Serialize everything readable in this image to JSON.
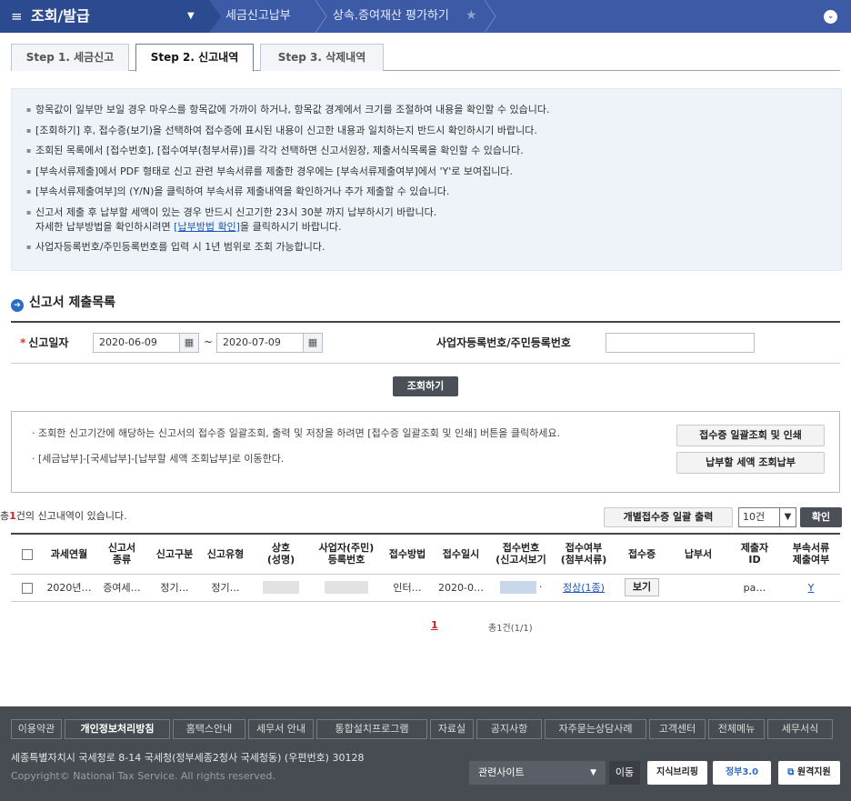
{
  "nav": {
    "title": "조회/발급",
    "crumb1": "세금신고납부",
    "crumb2": "상속.증여재산 평가하기"
  },
  "tabs": [
    {
      "label": "Step 1. 세금신고"
    },
    {
      "label": "Step 2. 신고내역"
    },
    {
      "label": "Step 3. 삭제내역"
    }
  ],
  "info": {
    "items": [
      "항목값이 일부만 보일 경우 마우스를 항목값에 가까이 하거나, 항목값 경계에서 크기를 조절하여 내용을 확인할 수 있습니다.",
      "[조회하기] 후, 접수증(보기)을 선택하여 접수증에 표시된 내용이 신고한 내용과 일치하는지 반드시 확인하시기 바랍니다.",
      "조회된 목록에서 [접수번호], [접수여부(첨부서류)]를 각각 선택하면 신고서원장, 제출서식목록을 확인할 수 있습니다.",
      "[부속서류제출]에서 PDF 형태로 신고 관련 부속서류를 제출한 경우에는 [부속서류제출여부]에서 'Y'로 보여집니다.",
      "[부속서류제출여부]의 (Y/N)을 클릭하여 부속서류 제출내역을 확인하거나 추가 제출할 수 있습니다.",
      "신고서 제출 후 납부할 세액이 있는 경우 반드시 신고기한 23시 30분 까지 납부하시기 바랍니다."
    ],
    "item7_pre": "자세한 납부방법을 확인하시려면 ",
    "item7_link": "[납부방법 확인]",
    "item7_post": "을 클릭하시기 바랍니다.",
    "item8": "사업자등록번호/주민등록번호를 입력 시 1년 범위로 조회 가능합니다."
  },
  "section": {
    "title": "신고서 제출목록"
  },
  "search": {
    "req": "*",
    "date_label": "신고일자",
    "from": "2020-06-09",
    "tilde": "~",
    "to": "2020-07-09",
    "biz_label": "사업자등록번호/주민등록번호",
    "button": "조회하기"
  },
  "notice": {
    "line1": "· 조회한 신고기간에 해당하는 신고서의 접수증 일괄조회, 출력 및 저장을 하려면 [접수증 일괄조회 및 인쇄] 버튼을 클릭하세요.",
    "line2": "· [세금납부]-[국세납부]-[납부할 세액 조회납부]로 이동한다.",
    "btn1": "접수증 일괄조회 및 인쇄",
    "btn2": "납부할 세액 조회납부"
  },
  "result": {
    "pre": "총",
    "count": "1",
    "post": "건의 신고내역이 있습니다.",
    "bulk_print": "개별접수증 일괄 출력",
    "page_size": "10건",
    "confirm": "확인"
  },
  "table": {
    "headers": {
      "year_month": "과세연월",
      "type1": "신고서",
      "type2": "종류",
      "category": "신고구분",
      "kind": "신고유형",
      "name1": "상호",
      "name2": "(성명)",
      "id1": "사업자(주민)",
      "id2": "등록번호",
      "method": "접수방법",
      "date": "접수일시",
      "recv1": "접수번호",
      "recv2": "(신고서보기",
      "status1": "접수여부",
      "status2": "(첨부서류)",
      "receipt": "접수증",
      "tax_office": "납부서",
      "submitter1": "제출자",
      "submitter2": "ID",
      "attach1": "부속서류",
      "attach2": "제출여부"
    },
    "row": {
      "year_month": "2020년…",
      "type": "증여세…",
      "category": "정기…",
      "kind": "정기…",
      "method": "인터…",
      "date": "2020-0…",
      "recv_suffix": "·",
      "status": "정상(1종)",
      "receipt": "보기",
      "submitter": "pa…",
      "attach": "Y"
    }
  },
  "pager": {
    "current": "1",
    "total": "총1건(1/1)"
  },
  "footer": {
    "links": [
      "이용약관",
      "개인정보처리방침",
      "홈택스안내",
      "세무서 안내",
      "통합설치프로그램",
      "자료실",
      "공지사항",
      "자주묻는상담사례",
      "고객센터",
      "전체메뉴",
      "세무서식"
    ],
    "address": "세종특별자치시 국세청로 8-14 국세청(정부세종2청사 국세청동) (우편번호) 30128",
    "copyright": "Copyright© National Tax Service. All rights reserved.",
    "related": "관련사이트",
    "go": "이동",
    "badge1": "지식브리핑",
    "badge2": "정부3.0",
    "badge3": "원격지원"
  }
}
